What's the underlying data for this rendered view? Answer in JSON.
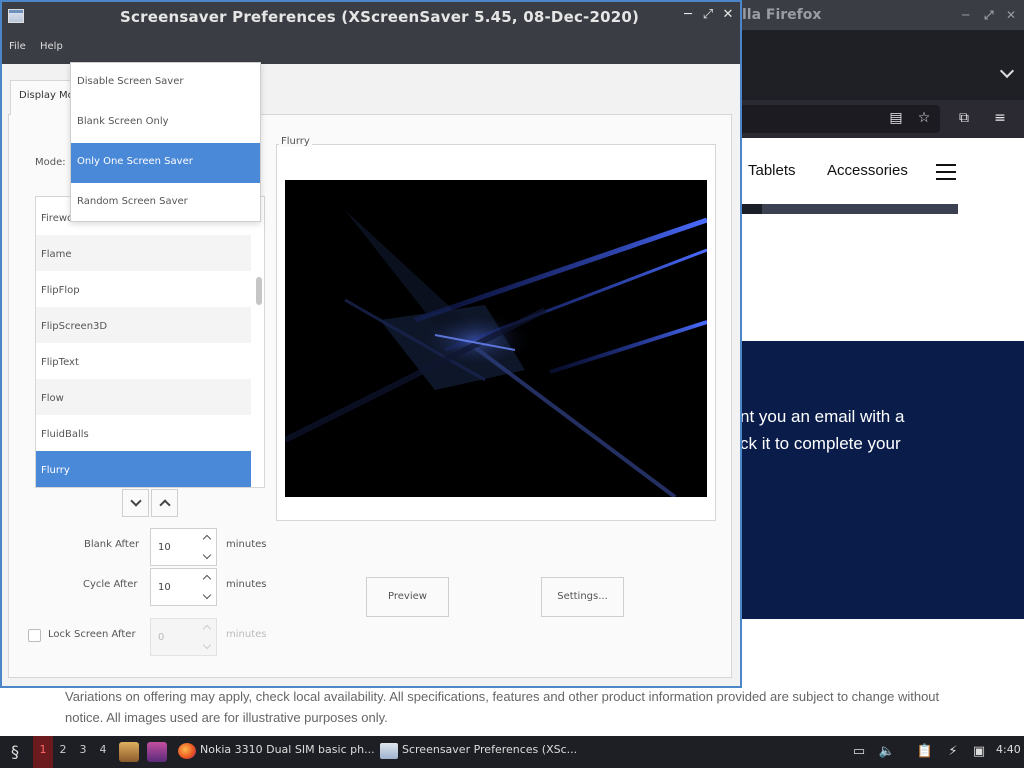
{
  "firefox": {
    "title": "lla Firefox",
    "nav_links": [
      "Tablets",
      "Accessories"
    ],
    "banner_line1": "nt you an email with a",
    "banner_line2": "ck it to complete your",
    "footer_text": "Variations on offering may apply, check local availability. All specifications, features and other product information provided are subject to change without notice. All images used are for illustrative purposes only."
  },
  "window": {
    "title": "Screensaver Preferences  (XScreenSaver 5.45, 08-Dec-2020)",
    "menu": [
      "File",
      "Help"
    ],
    "tab_label": "Display Modes"
  },
  "mode": {
    "label": "Mode:",
    "options": [
      "Disable Screen Saver",
      "Blank Screen Only",
      "Only One Screen Saver",
      "Random Screen Saver"
    ],
    "selected": "Only One Screen Saver"
  },
  "savers": {
    "items": [
      "Firewo",
      "Flame",
      "FlipFlop",
      "FlipScreen3D",
      "FlipText",
      "Flow",
      "FluidBalls",
      "Flurry"
    ],
    "selected": "Flurry"
  },
  "timing": {
    "blank_after_label": "Blank After",
    "blank_after_value": "10",
    "cycle_after_label": "Cycle After",
    "cycle_after_value": "10",
    "lock_label": "Lock Screen After",
    "lock_value": "0",
    "lock_checked": false,
    "unit": "minutes"
  },
  "preview": {
    "frame_label": "Flurry",
    "preview_button": "Preview",
    "settings_button": "Settings..."
  },
  "taskbar": {
    "workspaces": [
      "1",
      "2",
      "3",
      "4"
    ],
    "active_workspace": "1",
    "tasks": [
      "Nokia 3310 Dual SIM basic ph...",
      "Screensaver Preferences  (XSc..."
    ],
    "clock": "4:40"
  },
  "colors": {
    "selection": "#4a88d8",
    "titlebar": "#3b3d44",
    "window_border": "#4a86c8",
    "taskbar": "#1e1f24",
    "active_workspace": "#6b1a1e",
    "navy_banner": "#0a1d4a"
  }
}
